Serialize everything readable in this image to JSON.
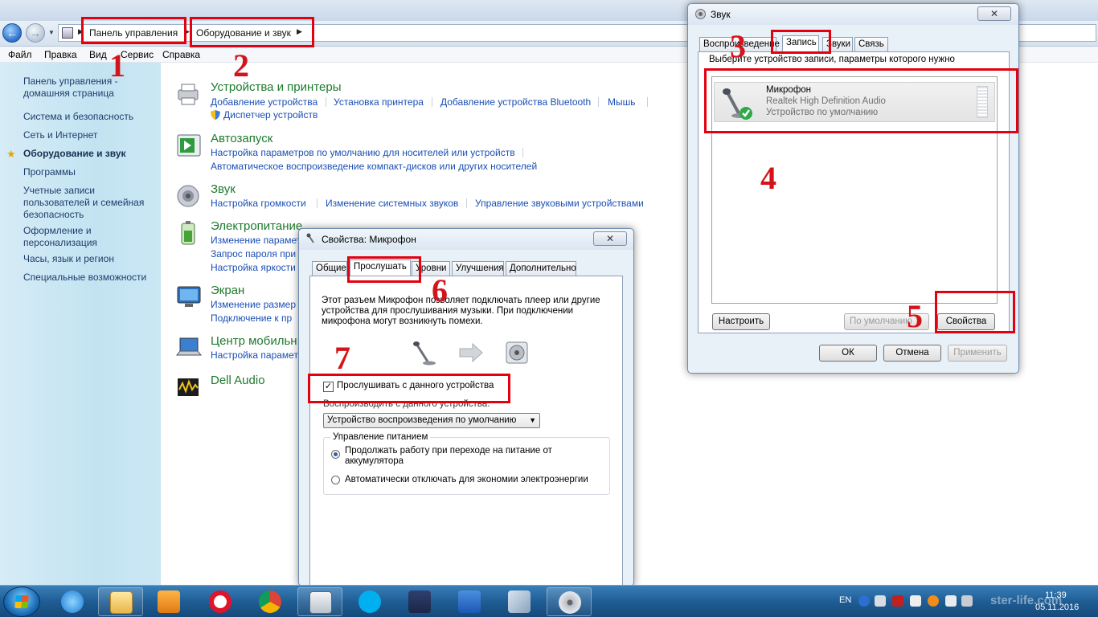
{
  "explorer": {
    "breadcrumb": {
      "item1": "Панель управления",
      "item2": "Оборудование и звук"
    },
    "menu": [
      "Файл",
      "Правка",
      "Вид",
      "Сервис",
      "Справка"
    ],
    "sidebar": {
      "items": [
        "Панель управления -\nдомашняя страница",
        "Система и безопасность",
        "Сеть и Интернет",
        "Оборудование и звук",
        "Программы",
        "Учетные записи\nпользователей и семейная\nбезопасность",
        "Оформление и\nперсонализация",
        "Часы, язык и регион",
        "Специальные возможности"
      ]
    },
    "categories": [
      {
        "title": "Устройства и принтеры",
        "links": [
          "Добавление устройства",
          "Установка принтера",
          "Добавление устройства Bluetooth",
          "Мышь",
          "Диспетчер устройств"
        ]
      },
      {
        "title": "Автозапуск",
        "links": [
          "Настройка параметров по умолчанию для носителей или устройств",
          "Автоматическое воспроизведение компакт-дисков или других носителей"
        ]
      },
      {
        "title": "Звук",
        "links": [
          "Настройка громкости",
          "Изменение системных звуков",
          "Управление звуковыми устройствами"
        ]
      },
      {
        "title": "Электропитание",
        "links": [
          "Изменение парамет",
          "Запрос пароля при",
          "Настройка яркости"
        ]
      },
      {
        "title": "Экран",
        "links": [
          "Изменение размер",
          "Подключение к пр"
        ]
      },
      {
        "title": "Центр мобильн",
        "links": [
          "Настройка парамет"
        ]
      },
      {
        "title": "Dell Audio",
        "links": []
      }
    ]
  },
  "sound_dialog": {
    "title": "Звук",
    "tabs": [
      "Воспроизведение",
      "Запись",
      "Звуки",
      "Связь"
    ],
    "instruction": "Выберите устройство записи, параметры которого нужно",
    "device": {
      "name": "Микрофон",
      "driver": "Realtek High Definition Audio",
      "status": "Устройство по умолчанию"
    },
    "buttons": {
      "configure": "Настроить",
      "default": "По умолчанию",
      "properties": "Свойства",
      "ok": "ОК",
      "cancel": "Отмена",
      "apply": "Применить"
    }
  },
  "mic_dialog": {
    "title": "Свойства: Микрофон",
    "tabs": [
      "Общие",
      "Прослушать",
      "Уровни",
      "Улучшения",
      "Дополнительно"
    ],
    "description": "Этот разъем Микрофон позволяет подключать плеер или другие устройства для прослушивания музыки. При подключении микрофона могут возникнуть помехи.",
    "listen_checkbox": "Прослушивать с данного устройства",
    "playback_label": "Воспроизводить с данного устройства:",
    "playback_value": "Устройство воспроизведения по умолчанию",
    "power_group": "Управление питанием",
    "power_option1": "Продолжать работу при переходе на питание от аккумулятора",
    "power_option2": "Автоматически отключать для экономии электроэнергии"
  },
  "marks": [
    "1",
    "2",
    "3",
    "4",
    "5",
    "6",
    "7"
  ],
  "taskbar": {
    "lang": "EN",
    "time": "11:39",
    "date": "05.11.2016",
    "watermark": "ster-life.com"
  },
  "colors": {
    "annotation_red": "#e3000f",
    "link_blue": "#1a4fb4",
    "category_green": "#1e7a2e"
  }
}
